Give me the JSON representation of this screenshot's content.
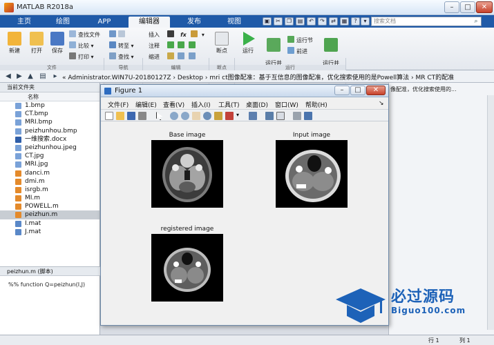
{
  "window": {
    "title": "MATLAB R2018a"
  },
  "tabs": [
    {
      "label": "主页"
    },
    {
      "label": "绘图"
    },
    {
      "label": "APP"
    },
    {
      "label": "编辑器"
    },
    {
      "label": "发布"
    },
    {
      "label": "视图"
    }
  ],
  "search": {
    "placeholder": "搜索文档"
  },
  "ribbon": {
    "file": {
      "section": "文件",
      "new": "新建",
      "open": "打开",
      "save": "保存",
      "find_files": "查找文件",
      "compare": "比较",
      "print": "打印"
    },
    "navigate": {
      "section": "导航",
      "goto": "转至",
      "find": "查找"
    },
    "edit": {
      "section": "编辑",
      "insert": "插入",
      "comment": "注释",
      "indent": "缩进",
      "fx": "fx"
    },
    "breakpoints": {
      "section": "断点",
      "label": "断点"
    },
    "run": {
      "section": "运行",
      "run": "运行",
      "run_advance": "运行并\n前进",
      "run_section": "运行节",
      "advance": "前进",
      "run_time": "运行并\n计时"
    }
  },
  "address": {
    "path": "« Administrator.WIN7U-20180127Z  ›  Desktop  ›  mri ct图像配准：基于互信息的图像配准，优化搜索使用的是Powell算法  ›  MR CT的配准"
  },
  "left_panel": {
    "title": "当前文件夹",
    "column": "名称",
    "files": [
      {
        "name": "1.bmp",
        "type": "img"
      },
      {
        "name": "CT.bmp",
        "type": "img"
      },
      {
        "name": "MRI.bmp",
        "type": "img"
      },
      {
        "name": "peizhunhou.bmp",
        "type": "img"
      },
      {
        "name": "一维搜索.docx",
        "type": "doc"
      },
      {
        "name": "peizhunhou.jpeg",
        "type": "img"
      },
      {
        "name": "CT.jpg",
        "type": "img"
      },
      {
        "name": "MRI.jpg",
        "type": "img"
      },
      {
        "name": "danci.m",
        "type": "m"
      },
      {
        "name": "dmi.m",
        "type": "m"
      },
      {
        "name": "isrgb.m",
        "type": "m"
      },
      {
        "name": "MI.m",
        "type": "m"
      },
      {
        "name": "POWELL.m",
        "type": "m"
      },
      {
        "name": "peizhun.m",
        "type": "m",
        "selected": true
      },
      {
        "name": "I.mat",
        "type": "mat"
      },
      {
        "name": "J.mat",
        "type": "mat"
      }
    ],
    "detail_title": "peizhun.m  (脚本)",
    "detail_text": "%% function Q=peizhun(I,J)"
  },
  "right_panel": {
    "top_text": "像配准，优化搜索使用的..."
  },
  "status": {
    "row_label": "行",
    "row_value": "1",
    "col_label": "列",
    "col_value": "1"
  },
  "figure": {
    "title": "Figure 1",
    "menus": [
      "文件(F)",
      "编辑(E)",
      "查看(V)",
      "插入(I)",
      "工具(T)",
      "桌面(D)",
      "窗口(W)",
      "帮助(H)"
    ],
    "images": [
      {
        "title": "Base image"
      },
      {
        "title": "Input image"
      },
      {
        "title": "registered image"
      }
    ]
  },
  "watermark": {
    "main": "必过源码",
    "sub": "Biguo100.com"
  }
}
